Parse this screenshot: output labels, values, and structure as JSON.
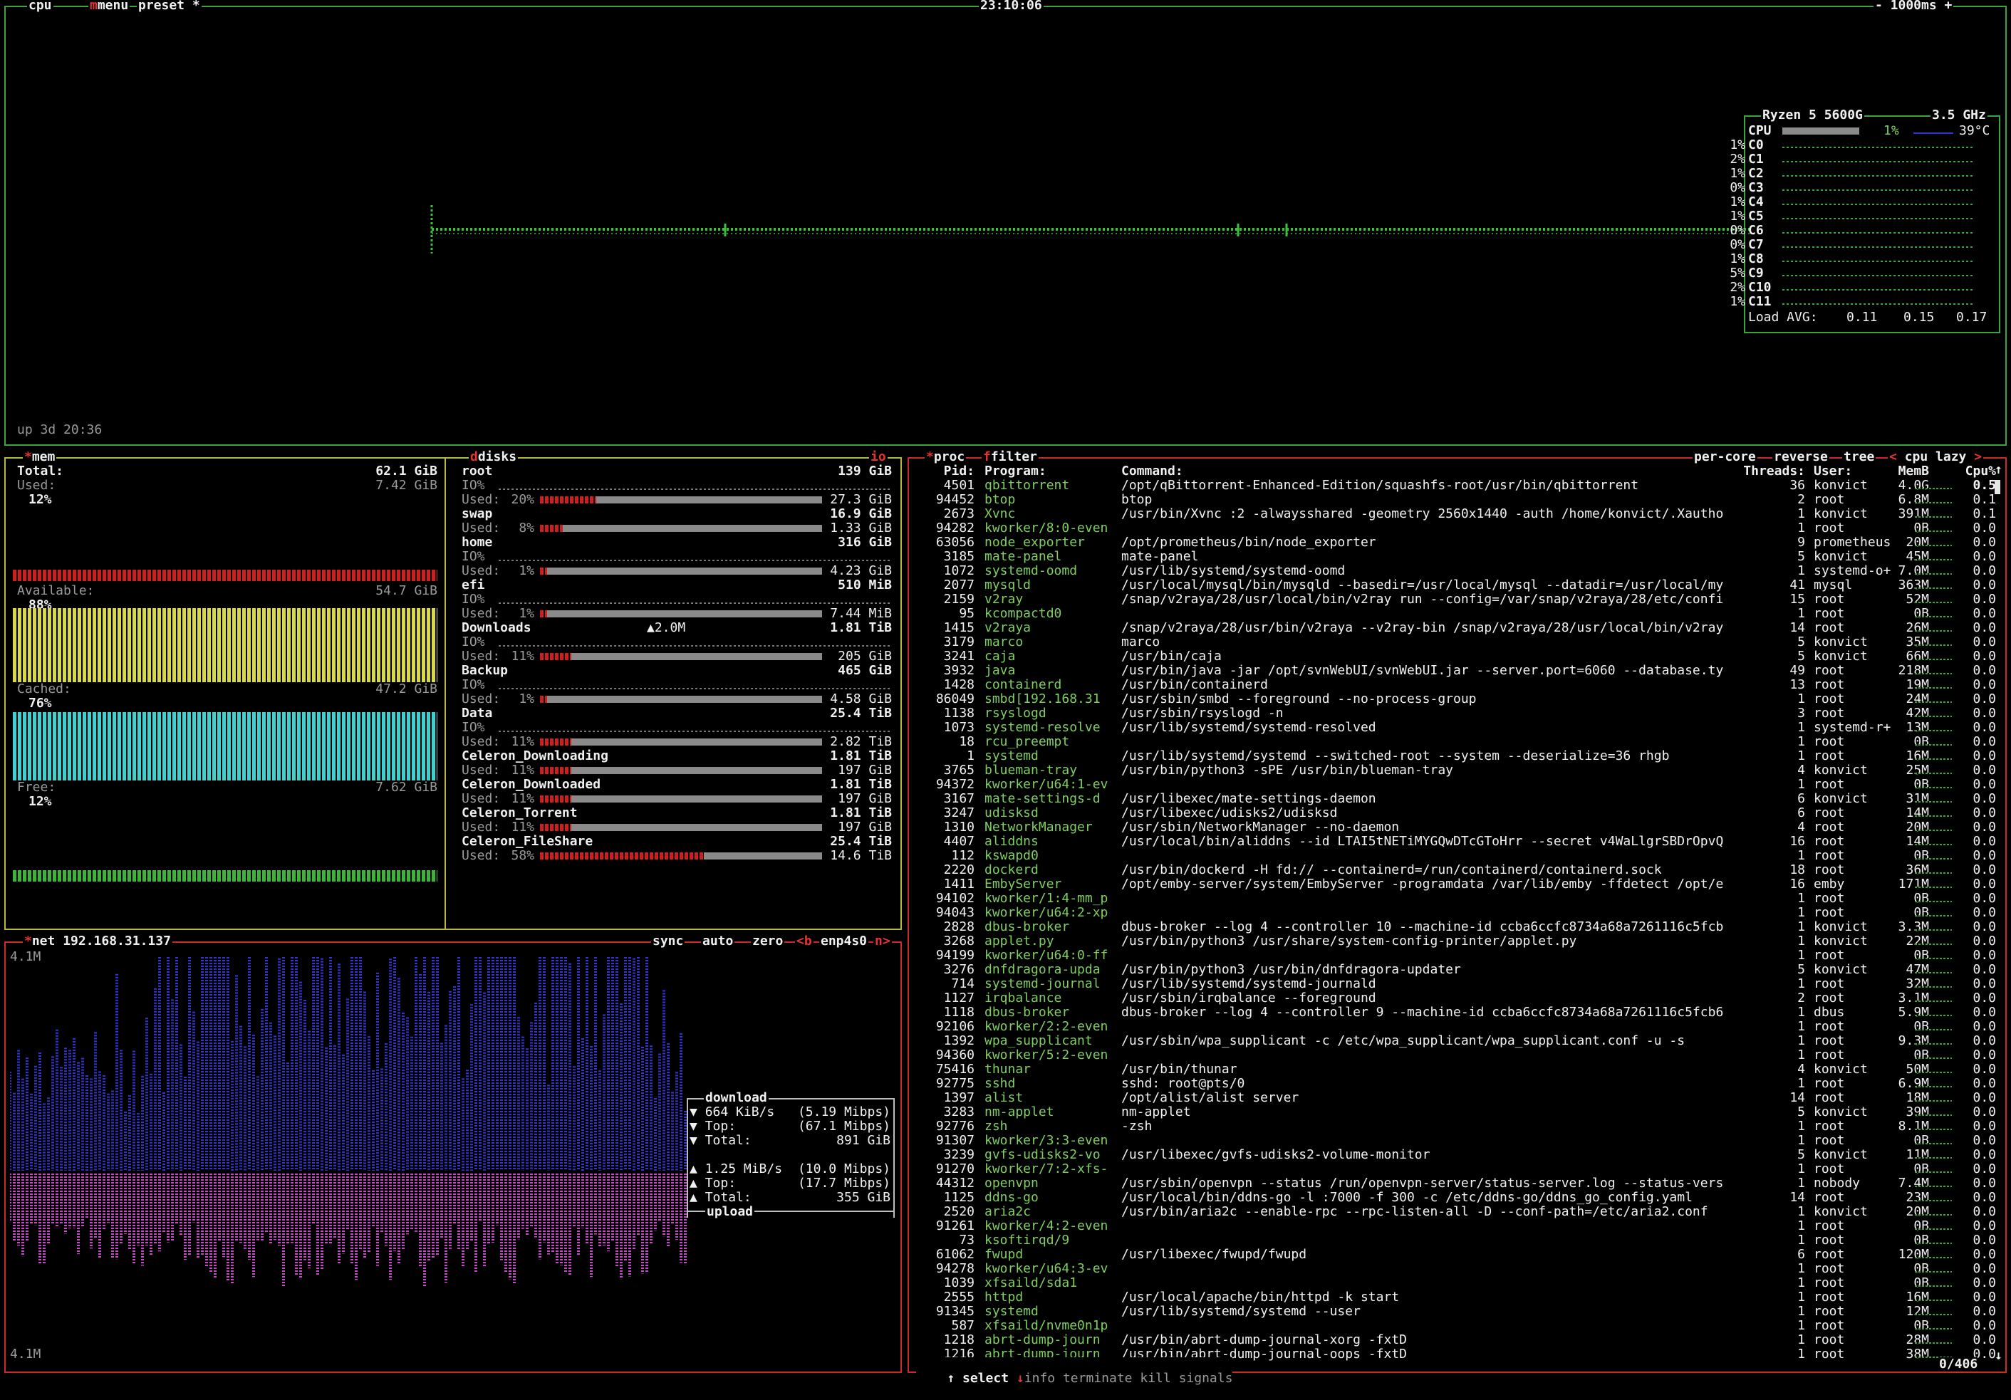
{
  "cpu": {
    "tab": "cpu",
    "menu": "menu",
    "preset": "preset",
    "preset_num": "*",
    "clock": "23:10:06",
    "interval": "- 1000ms +",
    "uptime": "up 3d 20:36",
    "model": "Ryzen 5 5600G",
    "freq": "3.5 GHz",
    "total_label": "CPU",
    "total_pct": "1%",
    "temp": "39°C",
    "cores": [
      {
        "name": "C0",
        "pct": "1%"
      },
      {
        "name": "C1",
        "pct": "2%"
      },
      {
        "name": "C2",
        "pct": "1%"
      },
      {
        "name": "C3",
        "pct": "0%"
      },
      {
        "name": "C4",
        "pct": "1%"
      },
      {
        "name": "C5",
        "pct": "1%"
      },
      {
        "name": "C6",
        "pct": "0%"
      },
      {
        "name": "C7",
        "pct": "0%"
      },
      {
        "name": "C8",
        "pct": "1%"
      },
      {
        "name": "C9",
        "pct": "5%"
      },
      {
        "name": "C10",
        "pct": "2%"
      },
      {
        "name": "C11",
        "pct": "1%"
      }
    ],
    "load_label": "Load AVG:",
    "load": [
      "0.11",
      "0.15",
      "0.17"
    ]
  },
  "mem": {
    "tab": "mem",
    "total_label": "Total:",
    "total": "62.1 GiB",
    "used_label": "Used:",
    "used": "7.42 GiB",
    "used_pct": "12%",
    "avail_label": "Available:",
    "avail": "54.7 GiB",
    "avail_pct": "88%",
    "cached_label": "Cached:",
    "cached": "47.2 GiB",
    "cached_pct": "76%",
    "free_label": "Free:",
    "free": "7.62 GiB",
    "free_pct": "12%"
  },
  "disks": {
    "tab": "disks",
    "toggle": "io",
    "items": [
      {
        "name": "root",
        "size": "139 GiB",
        "io": "IO%",
        "used_label": "Used:",
        "pct": "20%",
        "used": "27.3 GiB",
        "fill": 0.2
      },
      {
        "name": "swap",
        "size": "16.9 GiB",
        "io": "",
        "used_label": "Used:",
        "pct": "8%",
        "used": "1.33 GiB",
        "fill": 0.08
      },
      {
        "name": "home",
        "size": "316 GiB",
        "io": "IO%",
        "used_label": "Used:",
        "pct": "1%",
        "used": "4.23 GiB",
        "fill": 0.01
      },
      {
        "name": "efi",
        "size": "510 MiB",
        "io": "IO%",
        "used_label": "Used:",
        "pct": "1%",
        "used": "7.44 MiB",
        "fill": 0.01
      },
      {
        "name": "Downloads",
        "size": "1.81 TiB",
        "io": "IO%",
        "io_extra": "▲2.0M",
        "used_label": "Used:",
        "pct": "11%",
        "used": "205 GiB",
        "fill": 0.11
      },
      {
        "name": "Backup",
        "size": "465 GiB",
        "io": "IO%",
        "used_label": "Used:",
        "pct": "1%",
        "used": "4.58 GiB",
        "fill": 0.01
      },
      {
        "name": "Data",
        "size": "25.4 TiB",
        "io": "IO%",
        "used_label": "Used:",
        "pct": "11%",
        "used": "2.82 TiB",
        "fill": 0.11
      },
      {
        "name": "Celeron_Downloading",
        "size": "1.81 TiB",
        "io": "",
        "used_label": "Used:",
        "pct": "11%",
        "used": "197 GiB",
        "fill": 0.11
      },
      {
        "name": "Celeron_Downloaded",
        "size": "1.81 TiB",
        "io": "",
        "used_label": "Used:",
        "pct": "11%",
        "used": "197 GiB",
        "fill": 0.11
      },
      {
        "name": "Celeron_Torrent",
        "size": "1.81 TiB",
        "io": "",
        "used_label": "Used:",
        "pct": "11%",
        "used": "197 GiB",
        "fill": 0.11
      },
      {
        "name": "Celeron_FileShare",
        "size": "25.4 TiB",
        "io": "",
        "used_label": "Used:",
        "pct": "58%",
        "used": "14.6 TiB",
        "fill": 0.58
      }
    ]
  },
  "net": {
    "tab": "net",
    "ip": "192.168.31.137",
    "sync": "sync",
    "auto": "auto",
    "zero": "zero",
    "prev": "<b",
    "iface": "enp4s0",
    "next": "n>",
    "scale_top": "4.1M",
    "scale_bottom": "4.1M",
    "download_label": "download",
    "dl_rate": "664 KiB/s",
    "dl_bits": "(5.19 Mibps)",
    "dl_top_label": "Top:",
    "dl_top": "(67.1 Mibps)",
    "dl_total_label": "Total:",
    "dl_total": "891 GiB",
    "ul_rate": "1.25 MiB/s",
    "ul_bits": "(10.0 Mibps)",
    "ul_top_label": "Top:",
    "ul_top": "(17.7 Mibps)",
    "ul_total_label": "Total:",
    "ul_total": "355 GiB",
    "upload_label": "upload"
  },
  "proc": {
    "tab": "proc",
    "filter": "filter",
    "options": {
      "per_core": "per-core",
      "reverse": "reverse",
      "tree": "tree",
      "sort": "cpu lazy"
    },
    "headers": {
      "pid": "Pid:",
      "program": "Program:",
      "command": "Command:",
      "threads": "Threads:",
      "user": "User:",
      "mem": "MemB",
      "cpu": "Cpu%"
    },
    "rows": [
      [
        "4501",
        "qbittorrent",
        "/opt/qBittorrent-Enhanced-Edition/squashfs-root/usr/bin/qbittorrent",
        "36",
        "konvict",
        "4.0G",
        "0.5"
      ],
      [
        "94452",
        "btop",
        "btop",
        "2",
        "root",
        "6.8M",
        "0.1"
      ],
      [
        "2673",
        "Xvnc",
        "/usr/bin/Xvnc :2 -alwaysshared -geometry 2560x1440 -auth /home/konvict/.Xautho",
        "1",
        "konvict",
        "391M",
        "0.1"
      ],
      [
        "94282",
        "kworker/8:0-even",
        "",
        "1",
        "root",
        "0B",
        "0.0"
      ],
      [
        "63056",
        "node_exporter",
        "/opt/prometheus/bin/node_exporter",
        "9",
        "prometheus",
        "20M",
        "0.0"
      ],
      [
        "3185",
        "mate-panel",
        "mate-panel",
        "5",
        "konvict",
        "45M",
        "0.0"
      ],
      [
        "1072",
        "systemd-oomd",
        "/usr/lib/systemd/systemd-oomd",
        "1",
        "systemd-o+",
        "7.0M",
        "0.0"
      ],
      [
        "2077",
        "mysqld",
        "/usr/local/mysql/bin/mysqld --basedir=/usr/local/mysql --datadir=/usr/local/my",
        "41",
        "mysql",
        "363M",
        "0.0"
      ],
      [
        "2159",
        "v2ray",
        "/snap/v2raya/28/usr/local/bin/v2ray run --config=/var/snap/v2raya/28/etc/confi",
        "15",
        "root",
        "52M",
        "0.0"
      ],
      [
        "95",
        "kcompactd0",
        "",
        "1",
        "root",
        "0B",
        "0.0"
      ],
      [
        "1415",
        "v2raya",
        "/snap/v2raya/28/usr/bin/v2raya --v2ray-bin /snap/v2raya/28/usr/local/bin/v2ray",
        "14",
        "root",
        "26M",
        "0.0"
      ],
      [
        "3179",
        "marco",
        "marco",
        "5",
        "konvict",
        "35M",
        "0.0"
      ],
      [
        "3241",
        "caja",
        "/usr/bin/caja",
        "5",
        "konvict",
        "66M",
        "0.0"
      ],
      [
        "3932",
        "java",
        "/usr/bin/java -jar /opt/svnWebUI/svnWebUI.jar --server.port=6060 --database.ty",
        "49",
        "root",
        "218M",
        "0.0"
      ],
      [
        "1428",
        "containerd",
        "/usr/bin/containerd",
        "13",
        "root",
        "19M",
        "0.0"
      ],
      [
        "86049",
        "smbd[192.168.31",
        "/usr/sbin/smbd --foreground --no-process-group",
        "1",
        "root",
        "24M",
        "0.0"
      ],
      [
        "1138",
        "rsyslogd",
        "/usr/sbin/rsyslogd -n",
        "3",
        "root",
        "42M",
        "0.0"
      ],
      [
        "1073",
        "systemd-resolve",
        "/usr/lib/systemd/systemd-resolved",
        "1",
        "systemd-r+",
        "13M",
        "0.0"
      ],
      [
        "18",
        "rcu_preempt",
        "",
        "1",
        "root",
        "0B",
        "0.0"
      ],
      [
        "1",
        "systemd",
        "/usr/lib/systemd/systemd --switched-root --system --deserialize=36 rhgb",
        "1",
        "root",
        "16M",
        "0.0"
      ],
      [
        "3765",
        "blueman-tray",
        "/usr/bin/python3 -sPE /usr/bin/blueman-tray",
        "4",
        "konvict",
        "25M",
        "0.0"
      ],
      [
        "94372",
        "kworker/u64:1-ev",
        "",
        "1",
        "root",
        "0B",
        "0.0"
      ],
      [
        "3167",
        "mate-settings-d",
        "/usr/libexec/mate-settings-daemon",
        "6",
        "konvict",
        "31M",
        "0.0"
      ],
      [
        "3247",
        "udisksd",
        "/usr/libexec/udisks2/udisksd",
        "6",
        "root",
        "14M",
        "0.0"
      ],
      [
        "1310",
        "NetworkManager",
        "/usr/sbin/NetworkManager --no-daemon",
        "4",
        "root",
        "20M",
        "0.0"
      ],
      [
        "4407",
        "aliddns",
        "/usr/local/bin/aliddns --id LTAI5tNETiMYGQwDTcGToHrr --secret v4WaLlgrSBDrOpvQ",
        "16",
        "root",
        "14M",
        "0.0"
      ],
      [
        "112",
        "kswapd0",
        "",
        "1",
        "root",
        "0B",
        "0.0"
      ],
      [
        "2220",
        "dockerd",
        "/usr/bin/dockerd -H fd:// --containerd=/run/containerd/containerd.sock",
        "18",
        "root",
        "36M",
        "0.0"
      ],
      [
        "1411",
        "EmbyServer",
        "/opt/emby-server/system/EmbyServer -programdata /var/lib/emby -ffdetect /opt/e",
        "16",
        "emby",
        "171M",
        "0.0"
      ],
      [
        "94102",
        "kworker/1:4-mm_p",
        "",
        "1",
        "root",
        "0B",
        "0.0"
      ],
      [
        "94043",
        "kworker/u64:2-xp",
        "",
        "1",
        "root",
        "0B",
        "0.0"
      ],
      [
        "2828",
        "dbus-broker",
        "dbus-broker --log 4 --controller 10 --machine-id ccba6ccfc8734a68a7261116c5fcb",
        "1",
        "konvict",
        "3.3M",
        "0.0"
      ],
      [
        "3268",
        "applet.py",
        "/usr/bin/python3 /usr/share/system-config-printer/applet.py",
        "1",
        "konvict",
        "22M",
        "0.0"
      ],
      [
        "94199",
        "kworker/u64:0-ff",
        "",
        "1",
        "root",
        "0B",
        "0.0"
      ],
      [
        "3276",
        "dnfdragora-upda",
        "/usr/bin/python3 /usr/bin/dnfdragora-updater",
        "5",
        "konvict",
        "47M",
        "0.0"
      ],
      [
        "714",
        "systemd-journal",
        "/usr/lib/systemd/systemd-journald",
        "1",
        "root",
        "32M",
        "0.0"
      ],
      [
        "1127",
        "irqbalance",
        "/usr/sbin/irqbalance --foreground",
        "2",
        "root",
        "3.1M",
        "0.0"
      ],
      [
        "1118",
        "dbus-broker",
        "dbus-broker --log 4 --controller 9 --machine-id ccba6ccfc8734a68a7261116c5fcb6",
        "1",
        "dbus",
        "5.9M",
        "0.0"
      ],
      [
        "92106",
        "kworker/2:2-even",
        "",
        "1",
        "root",
        "0B",
        "0.0"
      ],
      [
        "1392",
        "wpa_supplicant",
        "/usr/sbin/wpa_supplicant -c /etc/wpa_supplicant/wpa_supplicant.conf -u -s",
        "1",
        "root",
        "9.3M",
        "0.0"
      ],
      [
        "94360",
        "kworker/5:2-even",
        "",
        "1",
        "root",
        "0B",
        "0.0"
      ],
      [
        "75416",
        "thunar",
        "/usr/bin/thunar",
        "4",
        "konvict",
        "50M",
        "0.0"
      ],
      [
        "92775",
        "sshd",
        "sshd: root@pts/0",
        "1",
        "root",
        "6.9M",
        "0.0"
      ],
      [
        "1397",
        "alist",
        "/opt/alist/alist server",
        "14",
        "root",
        "18M",
        "0.0"
      ],
      [
        "3283",
        "nm-applet",
        "nm-applet",
        "5",
        "konvict",
        "39M",
        "0.0"
      ],
      [
        "92776",
        "zsh",
        "-zsh",
        "1",
        "root",
        "8.1M",
        "0.0"
      ],
      [
        "91307",
        "kworker/3:3-even",
        "",
        "1",
        "root",
        "0B",
        "0.0"
      ],
      [
        "3239",
        "gvfs-udisks2-vo",
        "/usr/libexec/gvfs-udisks2-volume-monitor",
        "5",
        "konvict",
        "11M",
        "0.0"
      ],
      [
        "91270",
        "kworker/7:2-xfs-",
        "",
        "1",
        "root",
        "0B",
        "0.0"
      ],
      [
        "44312",
        "openvpn",
        "/usr/sbin/openvpn --status /run/openvpn-server/status-server.log --status-vers",
        "1",
        "nobody",
        "7.4M",
        "0.0"
      ],
      [
        "1125",
        "ddns-go",
        "/usr/local/bin/ddns-go -l :7000 -f 300 -c /etc/ddns-go/ddns_go_config.yaml",
        "14",
        "root",
        "23M",
        "0.0"
      ],
      [
        "2520",
        "aria2c",
        "/usr/bin/aria2c --enable-rpc --rpc-listen-all -D --conf-path=/etc/aria2.conf",
        "1",
        "konvict",
        "20M",
        "0.0"
      ],
      [
        "91261",
        "kworker/4:2-even",
        "",
        "1",
        "root",
        "0B",
        "0.0"
      ],
      [
        "73",
        "ksoftirqd/9",
        "",
        "1",
        "root",
        "0B",
        "0.0"
      ],
      [
        "61062",
        "fwupd",
        "/usr/libexec/fwupd/fwupd",
        "6",
        "root",
        "120M",
        "0.0"
      ],
      [
        "94278",
        "kworker/u64:3-ev",
        "",
        "1",
        "root",
        "0B",
        "0.0"
      ],
      [
        "1039",
        "xfsaild/sda1",
        "",
        "1",
        "root",
        "0B",
        "0.0"
      ],
      [
        "2555",
        "httpd",
        "/usr/local/apache/bin/httpd -k start",
        "1",
        "root",
        "16M",
        "0.0"
      ],
      [
        "91345",
        "systemd",
        "/usr/lib/systemd/systemd --user",
        "1",
        "root",
        "12M",
        "0.0"
      ],
      [
        "587",
        "xfsaild/nvme0n1p",
        "",
        "1",
        "root",
        "0B",
        "0.0"
      ],
      [
        "1218",
        "abrt-dump-journ",
        "/usr/bin/abrt-dump-journal-xorg -fxtD",
        "1",
        "root",
        "28M",
        "0.0"
      ],
      [
        "1216",
        "abrt-dump-journ",
        "/usr/bin/abrt-dump-journal-oops -fxtD",
        "1",
        "root",
        "38M",
        "0.0"
      ]
    ],
    "footer": {
      "up": "↑",
      "select": "select",
      "down": "↓",
      "info": "info",
      "terminate": "terminate",
      "kill": "kill",
      "signals": "signals",
      "count": "0/406"
    }
  },
  "colors": {
    "cpu_border": "#3aa53a",
    "mem_border": "#b8b83a",
    "net_border": "#cc2a2a",
    "proc_border": "#cc2a2a",
    "used": "#cc2020",
    "available": "#d8d84a",
    "cached": "#40d0d0",
    "free": "#3cb43c",
    "download": "#3434d0",
    "upload": "#c84ac8"
  }
}
